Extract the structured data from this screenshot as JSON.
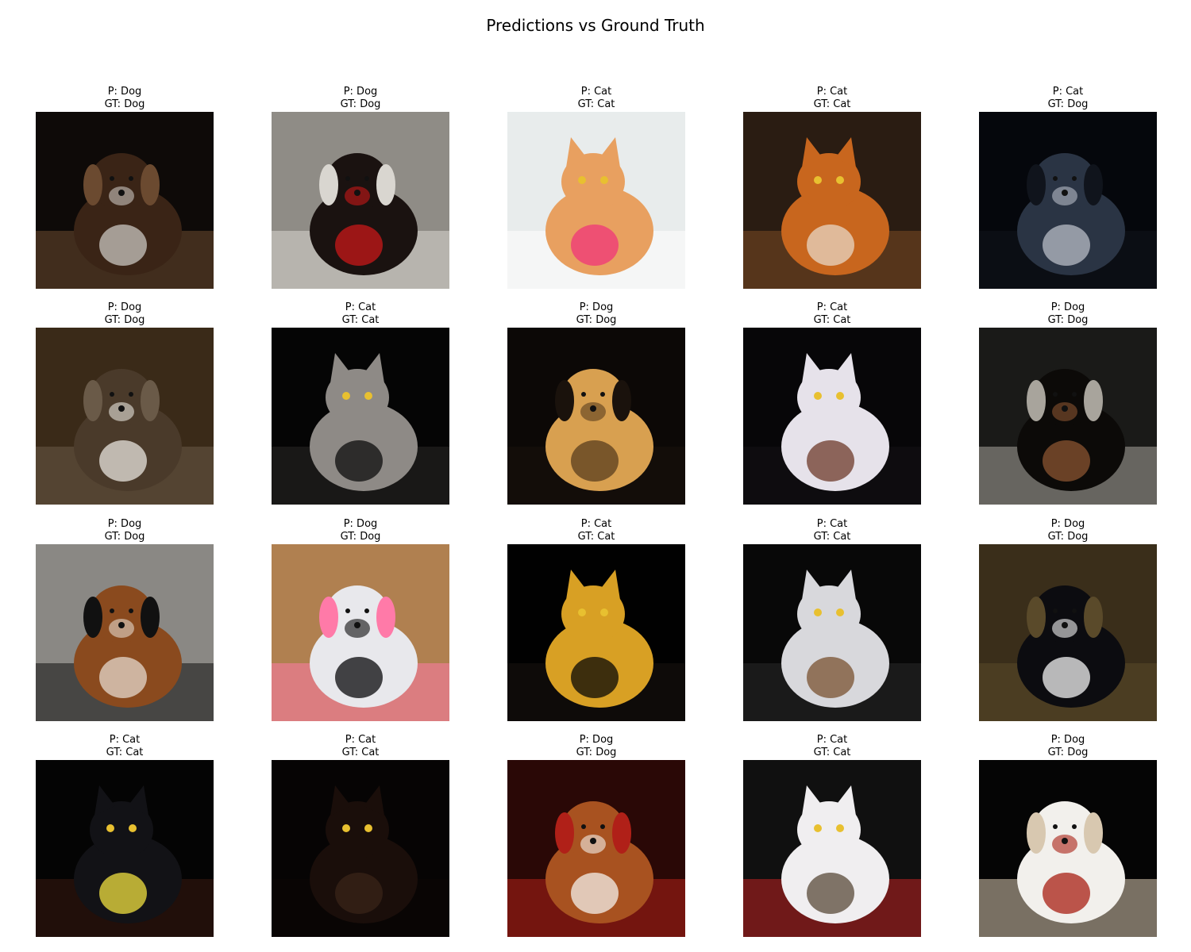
{
  "title": "Predictions vs Ground Truth",
  "panels": [
    {
      "pred": "P: Dog",
      "gt": "GT: Dog",
      "icon": "dog-photo",
      "colors": {
        "bg": "#0e0a08",
        "a": "#3a2416",
        "b": "#c9c5c0",
        "c": "#6b4a30"
      }
    },
    {
      "pred": "P: Dog",
      "gt": "GT: Dog",
      "icon": "dog-photo",
      "colors": {
        "bg": "#8f8c86",
        "a": "#1a1210",
        "b": "#c81818",
        "c": "#d9d6d0"
      }
    },
    {
      "pred": "P: Cat",
      "gt": "GT: Cat",
      "icon": "cat-photo",
      "colors": {
        "bg": "#e8ecec",
        "a": "#e8a060",
        "b": "#f0357a",
        "c": "#ffffff"
      }
    },
    {
      "pred": "P: Cat",
      "gt": "GT: Cat",
      "icon": "cat-photo",
      "colors": {
        "bg": "#2a1c12",
        "a": "#c8661e",
        "b": "#e8d7c4",
        "c": "#7a4a22"
      }
    },
    {
      "pred": "P: Cat",
      "gt": "GT: Dog",
      "icon": "dog-photo",
      "colors": {
        "bg": "#05070c",
        "a": "#2a3444",
        "b": "#b8bcc6",
        "c": "#10141c"
      }
    },
    {
      "pred": "P: Dog",
      "gt": "GT: Dog",
      "icon": "dog-photo",
      "colors": {
        "bg": "#3a2a18",
        "a": "#4a3a2a",
        "b": "#e8e4de",
        "c": "#6a5a48"
      }
    },
    {
      "pred": "P: Cat",
      "gt": "GT: Cat",
      "icon": "cat-photo",
      "colors": {
        "bg": "#050505",
        "a": "#8e8a86",
        "b": "#0c0c0c",
        "c": "#2a2826"
      }
    },
    {
      "pred": "P: Dog",
      "gt": "GT: Dog",
      "icon": "dog-photo",
      "colors": {
        "bg": "#0c0806",
        "a": "#d8a050",
        "b": "#5a3e1e",
        "c": "#1a120c"
      }
    },
    {
      "pred": "P: Cat",
      "gt": "GT: Cat",
      "icon": "cat-photo",
      "colors": {
        "bg": "#070608",
        "a": "#e6e2ea",
        "b": "#6e3a2a",
        "c": "#141216"
      }
    },
    {
      "pred": "P: Dog",
      "gt": "GT: Dog",
      "icon": "dog-photo",
      "colors": {
        "bg": "#1a1a18",
        "a": "#0c0a08",
        "b": "#8a5430",
        "c": "#a8a49c"
      }
    },
    {
      "pred": "P: Dog",
      "gt": "GT: Dog",
      "icon": "dog-photo",
      "colors": {
        "bg": "#8a8884",
        "a": "#8a4a1e",
        "b": "#e4d8cc",
        "c": "#111111"
      }
    },
    {
      "pred": "P: Dog",
      "gt": "GT: Dog",
      "icon": "dog-photo",
      "colors": {
        "bg": "#b08050",
        "a": "#e8e8ec",
        "b": "#0a0a0c",
        "c": "#ff7aa8"
      }
    },
    {
      "pred": "P: Cat",
      "gt": "GT: Cat",
      "icon": "cat-photo",
      "colors": {
        "bg": "#010101",
        "a": "#d8a024",
        "b": "#0a0806",
        "c": "#1a1410"
      }
    },
    {
      "pred": "P: Cat",
      "gt": "GT: Cat",
      "icon": "cat-photo",
      "colors": {
        "bg": "#080808",
        "a": "#d8d8dc",
        "b": "#7a5230",
        "c": "#2a2a2a"
      }
    },
    {
      "pred": "P: Dog",
      "gt": "GT: Dog",
      "icon": "dog-photo",
      "colors": {
        "bg": "#3a2e1a",
        "a": "#0c0c10",
        "b": "#f2f2f2",
        "c": "#5a4a2a"
      }
    },
    {
      "pred": "P: Cat",
      "gt": "GT: Cat",
      "icon": "cat-photo",
      "colors": {
        "bg": "#040404",
        "a": "#121216",
        "b": "#f0e040",
        "c": "#3a1a10"
      }
    },
    {
      "pred": "P: Cat",
      "gt": "GT: Cat",
      "icon": "cat-photo",
      "colors": {
        "bg": "#060404",
        "a": "#1a0e0a",
        "b": "#3a2418",
        "c": "#0c0806"
      }
    },
    {
      "pred": "P: Dog",
      "gt": "GT: Dog",
      "icon": "dog-photo",
      "colors": {
        "bg": "#2a0806",
        "a": "#a85220",
        "b": "#f4f0ea",
        "c": "#b02018"
      }
    },
    {
      "pred": "P: Cat",
      "gt": "GT: Cat",
      "icon": "cat-photo",
      "colors": {
        "bg": "#101010",
        "a": "#f0eef0",
        "b": "#5a4a3a",
        "c": "#c02020"
      }
    },
    {
      "pred": "P: Dog",
      "gt": "GT: Dog",
      "icon": "dog-photo",
      "colors": {
        "bg": "#050505",
        "a": "#f2f0ec",
        "b": "#a82014",
        "c": "#d8c8b0"
      }
    }
  ]
}
